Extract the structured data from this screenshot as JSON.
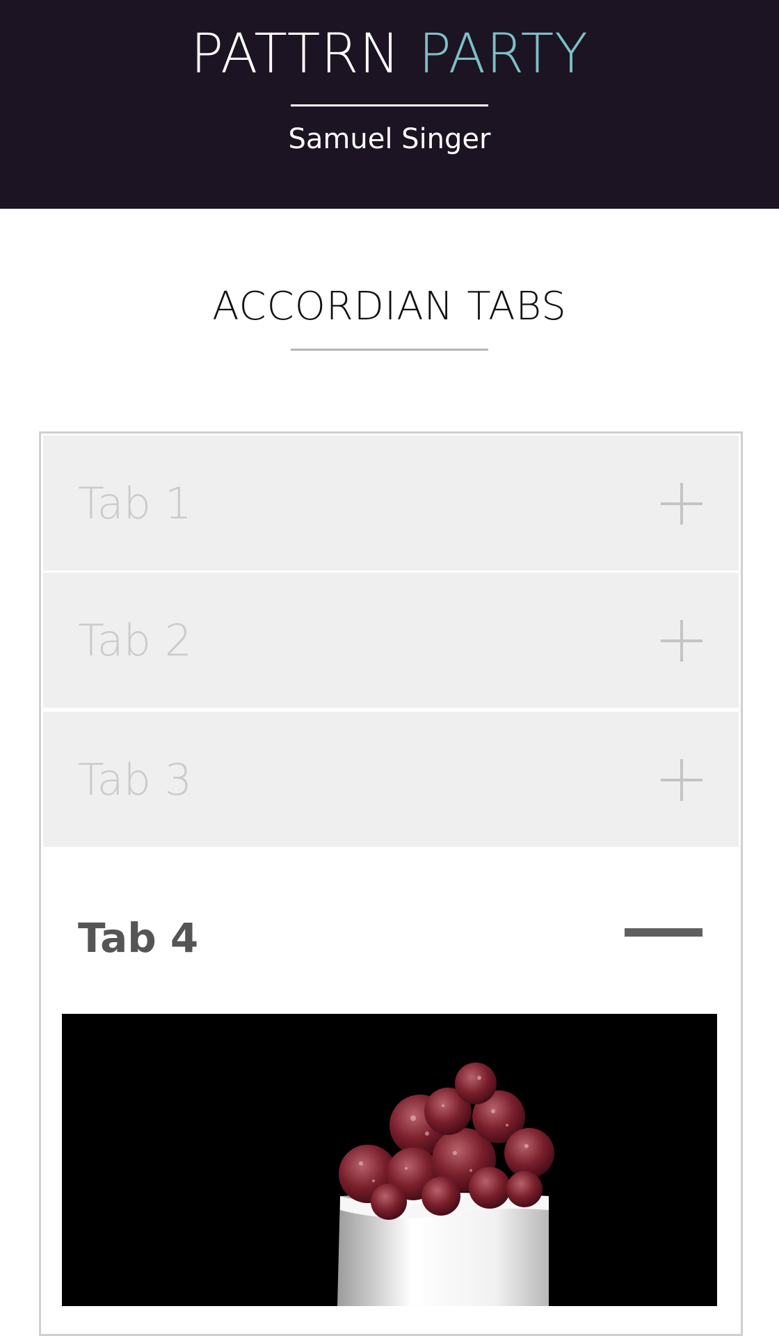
{
  "header": {
    "title_part1": "PATTRN",
    "title_part2": "PARTY",
    "author": "Samuel Singer",
    "colors": {
      "background": "#1c1423",
      "accent": "#7dbfc6"
    }
  },
  "section": {
    "title": "ACCORDIAN TABS"
  },
  "accordion": {
    "tabs": [
      {
        "label": "Tab 1",
        "state": "collapsed",
        "icon": "plus-icon"
      },
      {
        "label": "Tab 2",
        "state": "collapsed",
        "icon": "plus-icon"
      },
      {
        "label": "Tab 3",
        "state": "collapsed",
        "icon": "plus-icon"
      },
      {
        "label": "Tab 4",
        "state": "expanded",
        "icon": "minus-icon"
      }
    ],
    "open_panel": {
      "image": "raspberry-dessert-photo"
    }
  }
}
